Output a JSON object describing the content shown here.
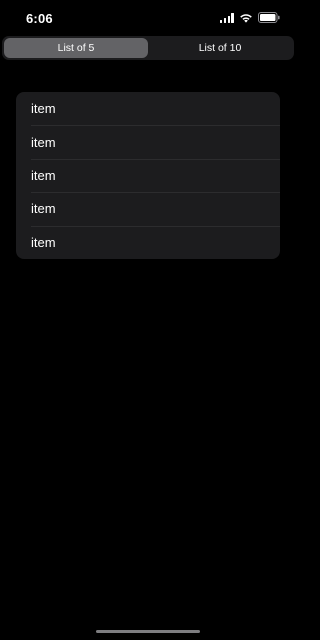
{
  "status_bar": {
    "time": "6:06",
    "icons": [
      "signal-icon",
      "wifi-icon",
      "battery-icon"
    ]
  },
  "segmented_control": {
    "segments": [
      {
        "label": "List of 5",
        "selected": true
      },
      {
        "label": "List of 10",
        "selected": false
      }
    ]
  },
  "list": {
    "items": [
      {
        "label": "item"
      },
      {
        "label": "item"
      },
      {
        "label": "item"
      },
      {
        "label": "item"
      },
      {
        "label": "item"
      }
    ]
  },
  "colors": {
    "background": "#000000",
    "card": "#1c1c1e",
    "segment_selected": "#636366",
    "text": "#ffffff"
  }
}
